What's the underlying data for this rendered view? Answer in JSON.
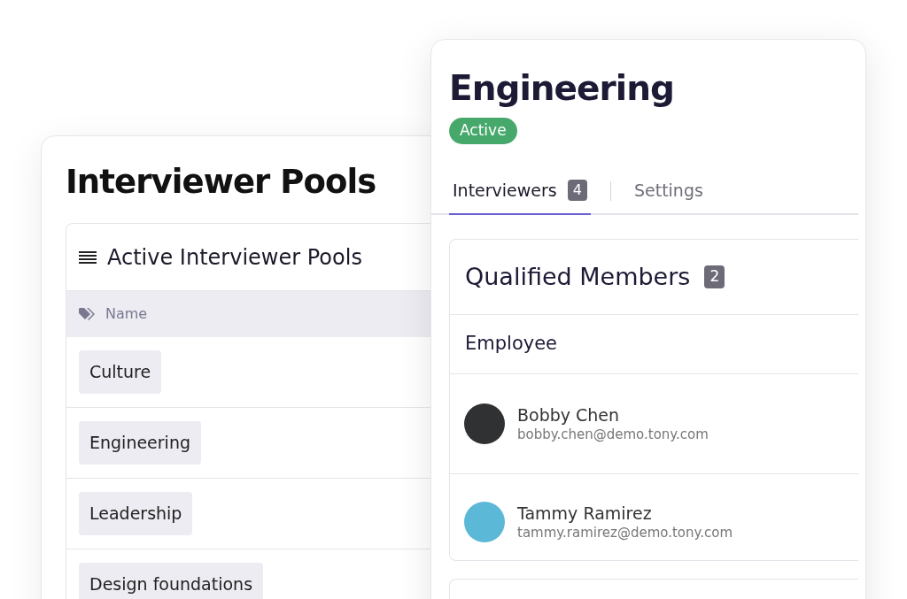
{
  "pools_card": {
    "title": "Interviewer Pools",
    "panel_title": "Active Interviewer Pools",
    "column": "Name",
    "rows": [
      "Culture",
      "Engineering",
      "Leadership",
      "Design foundations"
    ]
  },
  "pool_detail": {
    "title": "Engineering",
    "status": "Active",
    "tabs": [
      {
        "label": "Interviewers",
        "count": "4",
        "selected": true
      },
      {
        "label": "Settings",
        "selected": false
      }
    ],
    "section": {
      "title": "Qualified Members",
      "count": "2",
      "group": "Employee",
      "members": [
        {
          "name": "Bobby Chen",
          "email": "bobby.chen@demo.tony.com",
          "color": "#2f3133"
        },
        {
          "name": "Tammy Ramirez",
          "email": "tammy.ramirez@demo.tony.com",
          "color": "#5bb8d6"
        }
      ]
    }
  }
}
